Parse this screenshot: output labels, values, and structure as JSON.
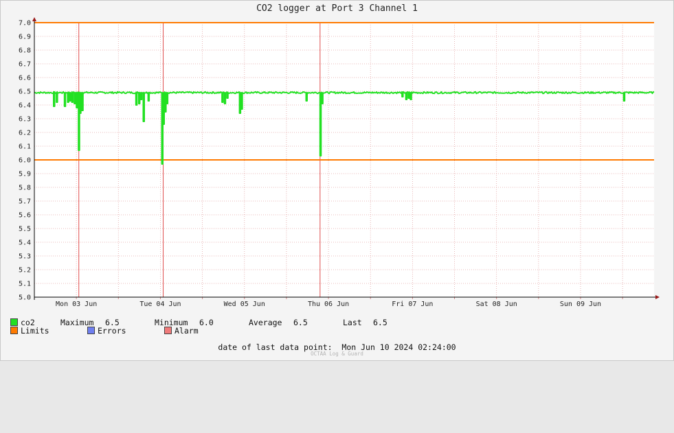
{
  "colors": {
    "background": "#f4f4f4",
    "plot_background": "#ffffff",
    "grid": "#e2a4a4",
    "axis": "#000000",
    "series_co2": "#22e022",
    "limits": "#ff7a00",
    "errors": "#6f7ff0",
    "alarm": "#f07a7a",
    "event_line": "#e05050"
  },
  "chart_data": {
    "type": "line",
    "title": "CO2 logger at Port 3 Channel 1",
    "x_tick_labels": [
      "Mon 03 Jun",
      "Tue 04 Jun",
      "Wed 05 Jun",
      "Thu 06 Jun",
      "Fri 07 Jun",
      "Sat 08 Jun",
      "Sun 09 Jun"
    ],
    "y_tick_labels": [
      "7.0",
      "6.9",
      "6.8",
      "6.7",
      "6.6",
      "6.5",
      "6.4",
      "6.3",
      "6.2",
      "6.1",
      "6.0",
      "5.9",
      "5.8",
      "5.7",
      "5.6",
      "5.5",
      "5.4",
      "5.3",
      "5.2",
      "5.1",
      "5.0"
    ],
    "ylim": [
      5.0,
      7.0
    ],
    "xlim_hours": [
      0,
      177
    ],
    "grid": true,
    "limits": [
      6.0,
      7.0
    ],
    "alarm_events_hours": [
      12.7,
      36.8,
      81.6
    ],
    "series": [
      {
        "name": "co2",
        "baseline": 6.49,
        "dips": [
          [
            5.5,
            6.39
          ],
          [
            6.3,
            6.42
          ],
          [
            8.6,
            6.39
          ],
          [
            9.5,
            6.42
          ],
          [
            10.0,
            6.43
          ],
          [
            10.7,
            6.42
          ],
          [
            11.4,
            6.41
          ],
          [
            12.0,
            6.38
          ],
          [
            12.6,
            6.07
          ],
          [
            13.0,
            6.34
          ],
          [
            13.6,
            6.36
          ],
          [
            29.0,
            6.4
          ],
          [
            29.8,
            6.41
          ],
          [
            30.4,
            6.44
          ],
          [
            31.1,
            6.28
          ],
          [
            32.5,
            6.43
          ],
          [
            36.4,
            5.97
          ],
          [
            36.8,
            6.26
          ],
          [
            37.3,
            6.35
          ],
          [
            37.8,
            6.41
          ],
          [
            53.6,
            6.42
          ],
          [
            54.3,
            6.41
          ],
          [
            55.0,
            6.45
          ],
          [
            58.6,
            6.34
          ],
          [
            59.1,
            6.37
          ],
          [
            77.6,
            6.43
          ],
          [
            81.6,
            6.03
          ],
          [
            82.1,
            6.41
          ],
          [
            105.0,
            6.46
          ],
          [
            106.1,
            6.44
          ],
          [
            106.8,
            6.45
          ],
          [
            107.4,
            6.44
          ],
          [
            168.3,
            6.43
          ]
        ],
        "last": 6.5
      }
    ]
  },
  "legend": {
    "co2_label": "co2",
    "max_label": "Maximum",
    "max_value": "6.5",
    "min_label": "Minimum",
    "min_value": "6.0",
    "avg_label": "Average",
    "avg_value": "6.5",
    "last_label": "Last",
    "last_value": "6.5",
    "limits_label": "Limits",
    "errors_label": "Errors",
    "alarm_label": "Alarm"
  },
  "footer": {
    "last_point": "date of last data point:  Mon Jun 10 2024 02:24:00",
    "watermark": "OCTAA Log & Guard"
  }
}
